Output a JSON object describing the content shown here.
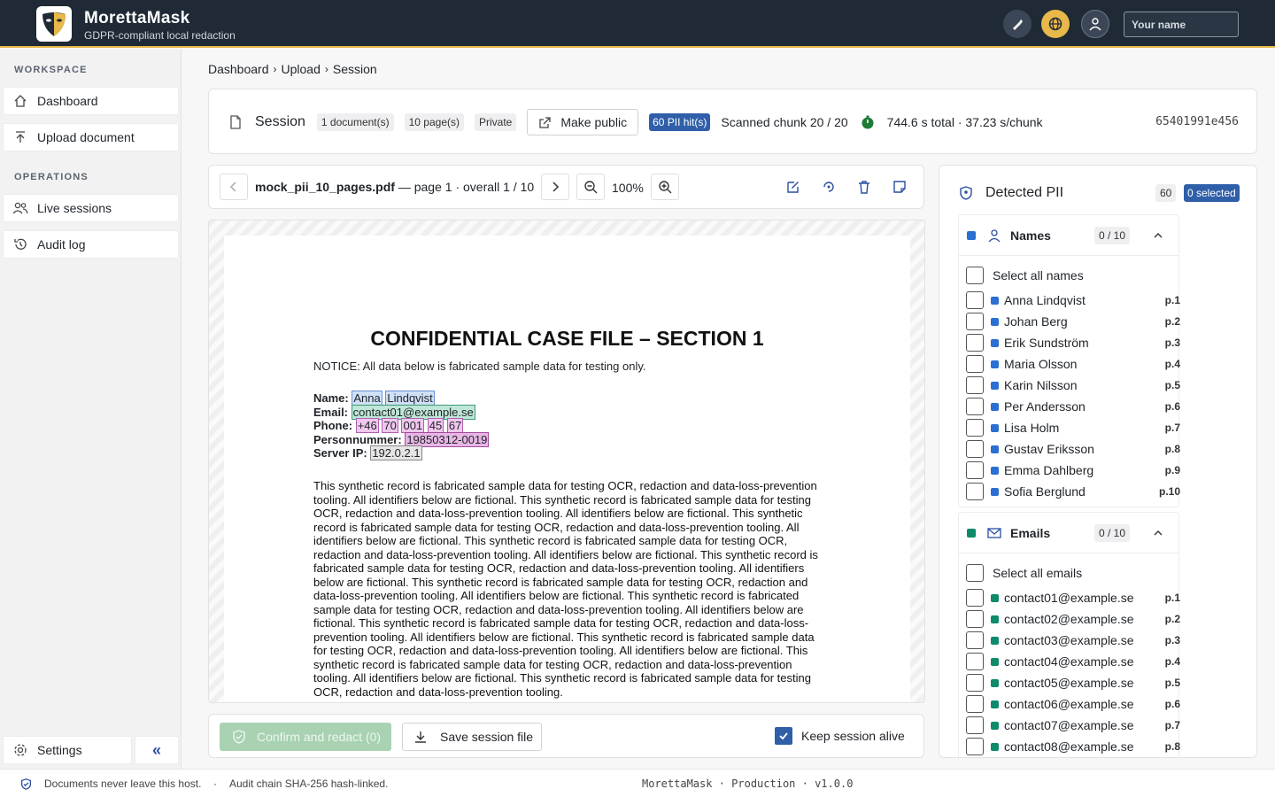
{
  "app": {
    "title": "MorettaMask",
    "subtitle": "GDPR-compliant local redaction",
    "name_placeholder": "Your name"
  },
  "sidebar": {
    "workspace_label": "WORKSPACE",
    "operations_label": "OPERATIONS",
    "items": [
      {
        "label": "Dashboard"
      },
      {
        "label": "Upload document"
      },
      {
        "label": "Live sessions"
      },
      {
        "label": "Audit log"
      }
    ],
    "settings_label": "Settings",
    "collapse_label": "«"
  },
  "breadcrumb": [
    "Dashboard",
    "Upload",
    "Session"
  ],
  "session": {
    "title": "Session",
    "docs": "1 document(s)",
    "pages": "10 page(s)",
    "visibility": "Private",
    "make_public": "Make public",
    "pii_hits": "60 PII hit(s)",
    "chunk": "Scanned chunk 20 / 20",
    "timing": "744.6 s total · 37.23 s/chunk",
    "id": "65401991e456"
  },
  "viewer": {
    "filename": "mock_pii_10_pages.pdf",
    "page_info": "— page 1 · overall 1 / 10",
    "zoom": "100%"
  },
  "document": {
    "heading": "CONFIDENTIAL CASE FILE – SECTION 1",
    "notice": "NOTICE: All data below is fabricated sample data for testing only.",
    "name_label": "Name:",
    "name_first": "Anna",
    "name_last": "Lindqvist",
    "email_label": "Email:",
    "email": "contact01@example.se",
    "phone_label": "Phone:",
    "phone": [
      "+46",
      "70",
      "001",
      "45",
      "67"
    ],
    "pnr_label": "Personnummer:",
    "pnr": "19850312-0019",
    "ip_label": "Server IP:",
    "ip": "192.0.2.1",
    "body": "This synthetic record is fabricated sample data for testing OCR, redaction and data-loss-prevention tooling. All identifiers below are fictional. This synthetic record is fabricated sample data for testing OCR, redaction and data-loss-prevention tooling. All identifiers below are fictional. This synthetic record is fabricated sample data for testing OCR, redaction and data-loss-prevention tooling. All identifiers below are fictional. This synthetic record is fabricated sample data for testing OCR, redaction and data-loss-prevention tooling. All identifiers below are fictional. This synthetic record is fabricated sample data for testing OCR, redaction and data-loss-prevention tooling. All identifiers below are fictional. This synthetic record is fabricated sample data for testing OCR, redaction and data-loss-prevention tooling. All identifiers below are fictional. This synthetic record is fabricated sample data for testing OCR, redaction and data-loss-prevention tooling. All identifiers below are fictional. This synthetic record is fabricated sample data for testing OCR, redaction and data-loss-prevention tooling. All identifiers below are fictional. This synthetic record is fabricated sample data for testing OCR, redaction and data-loss-prevention tooling. All identifiers below are fictional. This synthetic record is fabricated sample data for testing OCR, redaction and data-loss-prevention tooling. All identifiers below are fictional. This synthetic record is fabricated sample data for testing OCR, redaction and data-loss-prevention tooling."
  },
  "pii": {
    "title": "Detected PII",
    "count": "60",
    "selected": "0 selected",
    "names": {
      "title": "Names",
      "count": "0 / 10",
      "select_all": "Select all names",
      "items": [
        [
          "Anna Lindqvist",
          "p.1"
        ],
        [
          "Johan Berg",
          "p.2"
        ],
        [
          "Erik Sundström",
          "p.3"
        ],
        [
          "Maria Olsson",
          "p.4"
        ],
        [
          "Karin Nilsson",
          "p.5"
        ],
        [
          "Per Andersson",
          "p.6"
        ],
        [
          "Lisa Holm",
          "p.7"
        ],
        [
          "Gustav Eriksson",
          "p.8"
        ],
        [
          "Emma Dahlberg",
          "p.9"
        ],
        [
          "Sofia Berglund",
          "p.10"
        ]
      ]
    },
    "emails": {
      "title": "Emails",
      "count": "0 / 10",
      "select_all": "Select all emails",
      "items": [
        [
          "contact01@example.se",
          "p.1"
        ],
        [
          "contact02@example.se",
          "p.2"
        ],
        [
          "contact03@example.se",
          "p.3"
        ],
        [
          "contact04@example.se",
          "p.4"
        ],
        [
          "contact05@example.se",
          "p.5"
        ],
        [
          "contact06@example.se",
          "p.6"
        ],
        [
          "contact07@example.se",
          "p.7"
        ],
        [
          "contact08@example.se",
          "p.8"
        ]
      ]
    },
    "colors": {
      "names": "#2a6fd1",
      "emails": "#0f8a6a"
    }
  },
  "actions": {
    "confirm": "Confirm and redact (0)",
    "save": "Save session file",
    "keep_alive": "Keep session alive"
  },
  "footer": {
    "left": "Documents never leave this host.",
    "sep": "·",
    "middle": "Audit chain SHA-256 hash-linked.",
    "right": "MorettaMask · Production · v1.0.0"
  }
}
